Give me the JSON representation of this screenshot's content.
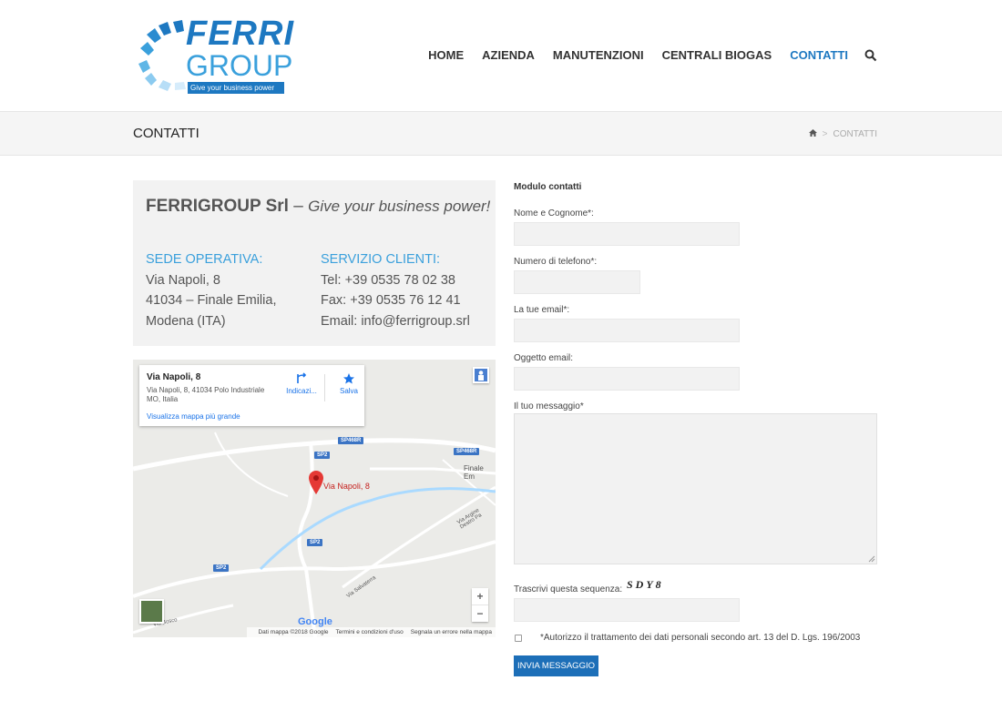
{
  "header": {
    "logo": {
      "word1": "FERRI",
      "word2": "GROUP",
      "tagline": "Give your business power"
    },
    "nav": [
      {
        "label": "HOME"
      },
      {
        "label": "AZIENDA"
      },
      {
        "label": "MANUTENZIONI"
      },
      {
        "label": "CENTRALI BIOGAS"
      },
      {
        "label": "CONTATTI",
        "active": true
      }
    ],
    "search_icon": "search-icon"
  },
  "titlebar": {
    "title": "CONTATTI",
    "breadcrumb_current": "CONTATTI",
    "home_icon": "home-icon"
  },
  "info": {
    "company": "FERRIGROUP Srl",
    "slogan_sep": " – ",
    "slogan": "Give your business power!",
    "sede": {
      "heading": "SEDE OPERATIVA:",
      "line1": "Via Napoli, 8",
      "line2": "41034 – Finale Emilia,",
      "line3": "Modena (ITA)"
    },
    "servizio": {
      "heading": "SERVIZIO CLIENTI:",
      "tel": "Tel: +39 0535 78 02 38",
      "fax": "Fax: +39 0535 76 12 41",
      "email": "Email: info@ferrigroup.srl"
    }
  },
  "map": {
    "card_title": "Via Napoli, 8",
    "card_address": "Via Napoli, 8, 41034 Polo Industriale MO, Italia",
    "directions": "Indicazi...",
    "save": "Salva",
    "view_larger": "Visualizza mappa più grande",
    "pin_label": "Via Napoli, 8",
    "roads": [
      "SP468R",
      "SP468R",
      "SP2",
      "SP2",
      "SP2"
    ],
    "place": "Finale Em",
    "street1": "Via Argine Destro Pa",
    "street2": "Via Salvaterra",
    "street3": "Via Bosco",
    "google": "Google",
    "footer": [
      "Dati mappa ©2018 Google",
      "Termini e condizioni d'uso",
      "Segnala un errore nella mappa"
    ],
    "zoom_in": "+",
    "zoom_out": "−"
  },
  "form": {
    "title": "Modulo contatti",
    "name_label": "Nome e Cognome*:",
    "phone_label": "Numero di telefono*:",
    "email_label": "La tue email*:",
    "subject_label": "Oggetto email:",
    "message_label": "Il tuo messaggio*",
    "captcha_label": "Trascrivi questa sequenza:",
    "captcha": "SDY8",
    "consent": "*Autorizzo il trattamento dei dati personali secondo art. 13 del D. Lgs. 196/2003",
    "submit": "INVIA MESSAGGIO"
  },
  "colors": {
    "accent": "#1d78c1",
    "light_accent": "#3aa0dc",
    "button": "#1d6fb8"
  }
}
